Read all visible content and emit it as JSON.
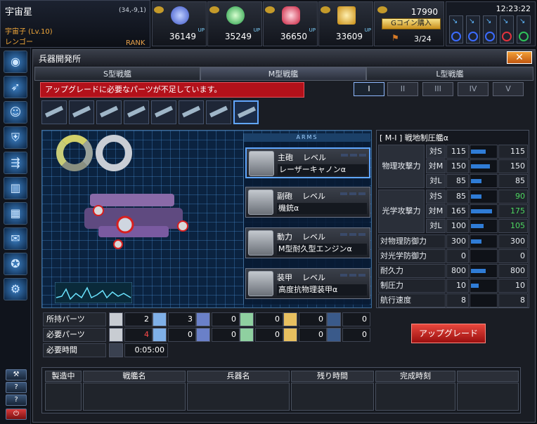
{
  "header": {
    "planet": "宇宙星",
    "coords": "(34,-9,1)",
    "player": "宇宙子 (Lv.10)",
    "area": "レンゴー",
    "rank_label": "RANK",
    "resources": [
      {
        "icon": "blue-crystal-icon",
        "value": "36149",
        "up": "UP",
        "color": "#5a7cf0"
      },
      {
        "icon": "green-orb-icon",
        "value": "35249",
        "up": "UP",
        "color": "#39d86a"
      },
      {
        "icon": "red-capsule-icon",
        "value": "36650",
        "up": "UP",
        "color": "#e8425a"
      },
      {
        "icon": "gold-bars-icon",
        "value": "33609",
        "up": "UP",
        "color": "#f0b728"
      }
    ],
    "gcoin": {
      "value": "17990",
      "button": "Gコイン購入",
      "fleet": "3/24"
    },
    "clock": "12:23:22"
  },
  "sidebar_buttons": [
    "?",
    "?",
    "⏻"
  ],
  "panel": {
    "title": "兵器開発所",
    "close": "✕",
    "tabs": [
      "S型戦艦",
      "M型戦艦",
      "L型戦艦"
    ],
    "warning": "アップグレードに必要なパーツが不足しています。",
    "tiers": [
      "I",
      "II",
      "III",
      "IV",
      "V"
    ],
    "arms_header": "ARMS",
    "arms": [
      {
        "name": "主砲",
        "level": "レベル",
        "value": "レーザーキャノンα"
      },
      {
        "name": "副砲",
        "level": "レベル",
        "value": "機銃α"
      },
      {
        "name": "動力",
        "level": "レベル",
        "value": "M型耐久型エンジンα"
      },
      {
        "name": "装甲",
        "level": "レベル",
        "value": "高度抗物理装甲α"
      }
    ],
    "stats_title": "[ M-I ] 戦地制圧艦α",
    "stats": {
      "phys_atk": "物理攻撃力",
      "opt_atk": "光学攻撃力",
      "rows": [
        {
          "sub": "対S",
          "cur": "115",
          "next": "115",
          "bar": 0.55,
          "up": false
        },
        {
          "sub": "対M",
          "cur": "150",
          "next": "150",
          "bar": 0.7,
          "up": false
        },
        {
          "sub": "対L",
          "cur": "85",
          "next": "85",
          "bar": 0.4,
          "up": false
        },
        {
          "sub": "対S",
          "cur": "85",
          "next": "90",
          "bar": 0.4,
          "up": true
        },
        {
          "sub": "対M",
          "cur": "165",
          "next": "175",
          "bar": 0.78,
          "up": true
        },
        {
          "sub": "対L",
          "cur": "100",
          "next": "105",
          "bar": 0.48,
          "up": true
        }
      ],
      "others": [
        {
          "label": "対物理防御力",
          "cur": "300",
          "next": "300",
          "bar": 0.4
        },
        {
          "label": "対光学防御力",
          "cur": "0",
          "next": "0",
          "bar": 0
        },
        {
          "label": "耐久力",
          "cur": "800",
          "next": "800",
          "bar": 0.55
        },
        {
          "label": "制圧力",
          "cur": "10",
          "next": "10",
          "bar": 0.3
        },
        {
          "label": "航行速度",
          "cur": "8",
          "next": "8",
          "bar": 0
        }
      ]
    },
    "parts": {
      "owned_label": "所持パーツ",
      "needed_label": "必要パーツ",
      "time_label": "必要時間",
      "owned": [
        "2",
        "3",
        "0",
        "0",
        "0",
        "0"
      ],
      "needed": [
        "4",
        "0",
        "0",
        "0",
        "0",
        "0"
      ],
      "time": "0:05:00"
    },
    "upgrade_button": "アップグレード",
    "production_headers": [
      "製造中",
      "戦艦名",
      "兵器名",
      "残り時間",
      "完成時刻"
    ]
  }
}
